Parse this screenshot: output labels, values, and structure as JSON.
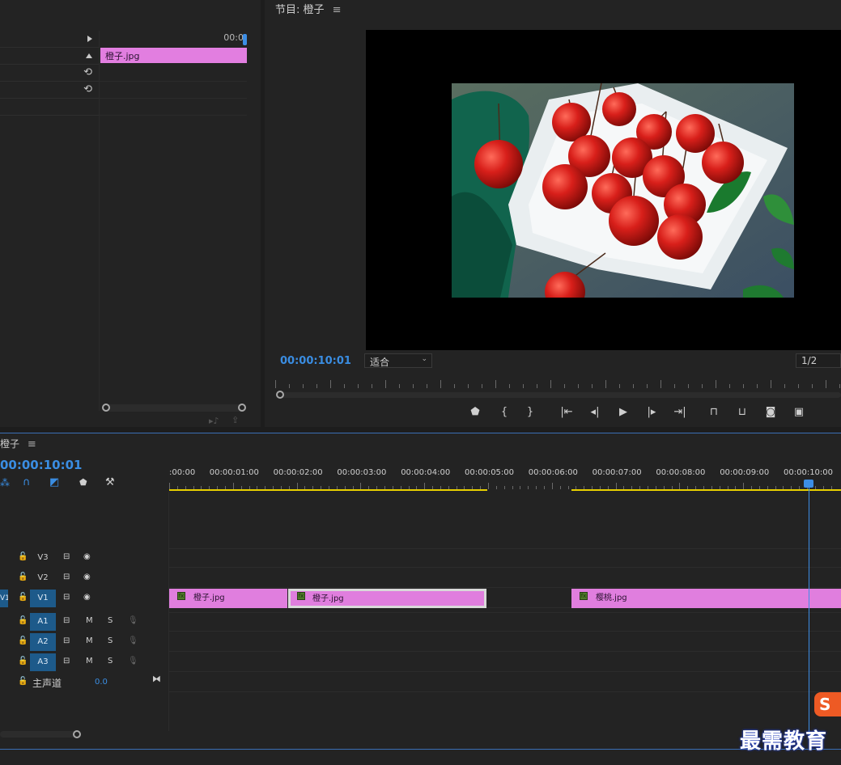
{
  "effect_controls": {
    "ruler_time": "00:0",
    "clip_name": "橙子.jpg",
    "reset_icon": "reset-icon"
  },
  "program_monitor": {
    "title": "节目: 橙子",
    "menu_icon": "≡",
    "timecode": "00:00:10:01",
    "zoom_value": "适合",
    "resolution_value": "1/2",
    "image_subject": "cherries on white plate"
  },
  "timeline": {
    "sequence_name": "橙子",
    "menu_icon": "≡",
    "timecode": "00:00:10:01",
    "ruler_labels": [
      ":00:00",
      "00:00:01:00",
      "00:00:02:00",
      "00:00:03:00",
      "00:00:04:00",
      "00:00:05:00",
      "00:00:06:00",
      "00:00:07:00",
      "00:00:08:00",
      "00:00:09:00",
      "00:00:10:00"
    ],
    "tracks": {
      "v3": {
        "name": "V3"
      },
      "v2": {
        "name": "V2"
      },
      "v1": {
        "name": "V1",
        "source": "V1"
      },
      "a1": {
        "name": "A1",
        "m": "M",
        "s": "S"
      },
      "a2": {
        "name": "A2",
        "m": "M",
        "s": "S"
      },
      "a3": {
        "name": "A3",
        "m": "M",
        "s": "S"
      },
      "master": {
        "name": "主声道",
        "value": "0.0"
      }
    },
    "clips": [
      {
        "name": "橙子.jpg"
      },
      {
        "name": "橙子.jpg"
      },
      {
        "name": "樱桃.jpg"
      }
    ]
  },
  "watermark": {
    "text": "最需教育",
    "logo_letter": "S"
  },
  "colors": {
    "accent_blue": "#3a8de2",
    "clip_pink": "#e07ede",
    "workarea_yellow": "#e8d000"
  }
}
